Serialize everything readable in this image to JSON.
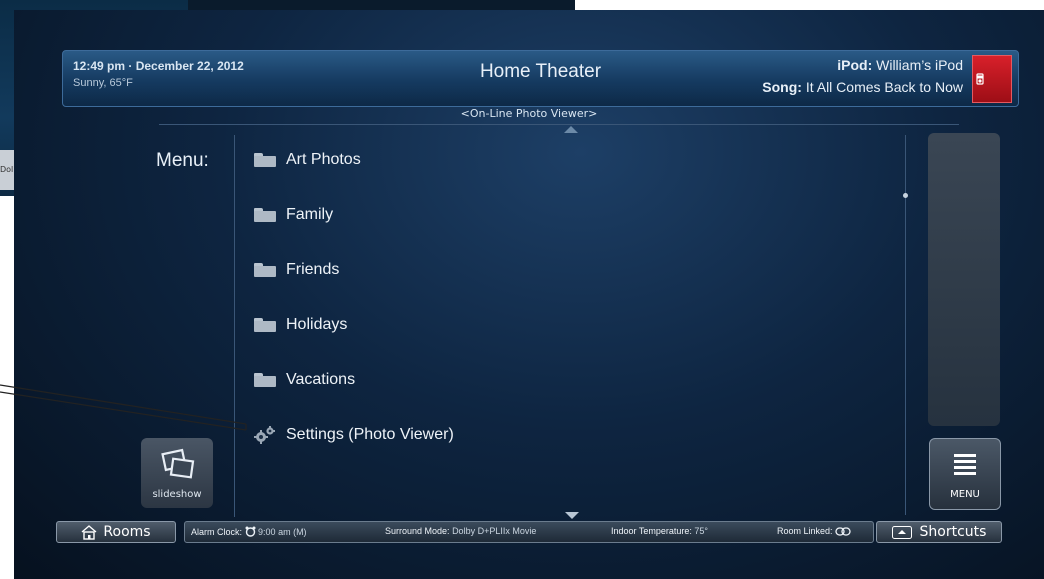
{
  "header": {
    "datetime": "12:49 pm · December 22, 2012",
    "weather": "Sunny, 65°F",
    "title": "Home Theater",
    "ipod_label": "iPod:",
    "ipod_value": "William’s iPod",
    "song_label": "Song:",
    "song_value": "It All Comes Back to Now"
  },
  "subtitle": "<On-Line Photo Viewer>",
  "menu_label": "Menu:",
  "menu_items": [
    {
      "label": "Art Photos",
      "icon": "folder-icon"
    },
    {
      "label": "Family",
      "icon": "folder-icon"
    },
    {
      "label": "Friends",
      "icon": "folder-icon"
    },
    {
      "label": "Holidays",
      "icon": "folder-icon"
    },
    {
      "label": "Vacations",
      "icon": "folder-icon"
    },
    {
      "label": "Settings (Photo Viewer)",
      "icon": "gears-icon"
    }
  ],
  "slideshow_label": "slideshow",
  "menu_button_label": "MENU",
  "footer": {
    "rooms_label": "Rooms",
    "shortcuts_label": "Shortcuts",
    "alarm_label": "Alarm Clock:",
    "alarm_value": "9:00 am (M)",
    "surround_label": "Surround Mode:",
    "surround_value": "Dolby D+PLIIx Movie",
    "temp_label": "Indoor Temperature:",
    "temp_value": "75°",
    "linked_label": "Room Linked:"
  },
  "background_strip_text": "Dol",
  "colors": {
    "accent_blue": "#2a5a86",
    "brand_red": "#d8202a"
  }
}
